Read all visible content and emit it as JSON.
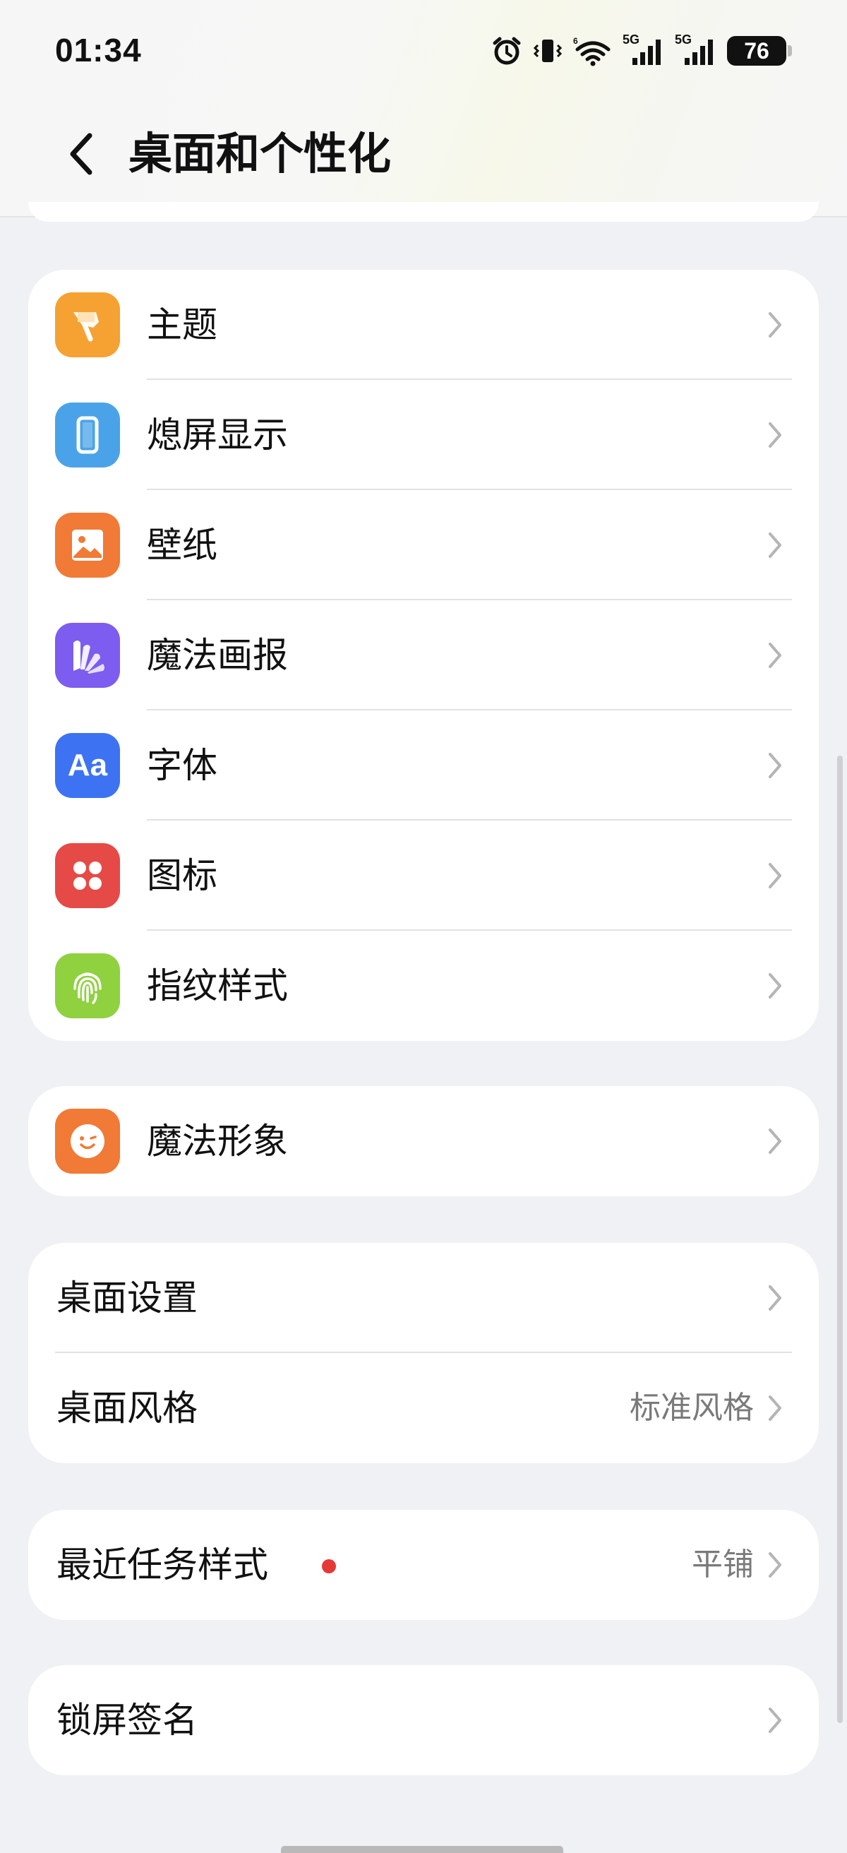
{
  "status_bar": {
    "time": "01:34",
    "network_5g_1": "5G",
    "network_5g_2": "5G",
    "battery": "76",
    "icons": [
      "alarm-icon",
      "vibrate-icon",
      "wifi-icon",
      "signal-icon",
      "signal-icon",
      "battery-icon"
    ]
  },
  "header": {
    "title": "桌面和个性化",
    "back_icon": "chevron-left-icon"
  },
  "groups": {
    "personalization": [
      {
        "label": "主题",
        "icon": "brush-icon",
        "color": "#f5a233"
      },
      {
        "label": "熄屏显示",
        "icon": "phone-outline-icon",
        "color": "#4aa3e8"
      },
      {
        "label": "壁纸",
        "icon": "image-icon",
        "color": "#f07a36"
      },
      {
        "label": "魔法画报",
        "icon": "magazine-icon",
        "color": "#7d5cf0"
      },
      {
        "label": "字体",
        "icon": "font-icon",
        "icon_text": "Aa",
        "color": "#3d73f2"
      },
      {
        "label": "图标",
        "icon": "four-dots-icon",
        "color": "#e64a46"
      },
      {
        "label": "指纹样式",
        "icon": "fingerprint-icon",
        "color": "#8fd13f"
      }
    ],
    "avatar": [
      {
        "label": "魔法形象",
        "icon": "smile-face-icon",
        "color": "#f07a36"
      }
    ],
    "desktop": [
      {
        "label": "桌面设置",
        "value": ""
      },
      {
        "label": "桌面风格",
        "value": "标准风格"
      }
    ],
    "recent": [
      {
        "label": "最近任务样式",
        "value": "平铺",
        "has_dot": true
      }
    ],
    "lock": [
      {
        "label": "锁屏签名",
        "value": ""
      }
    ]
  }
}
